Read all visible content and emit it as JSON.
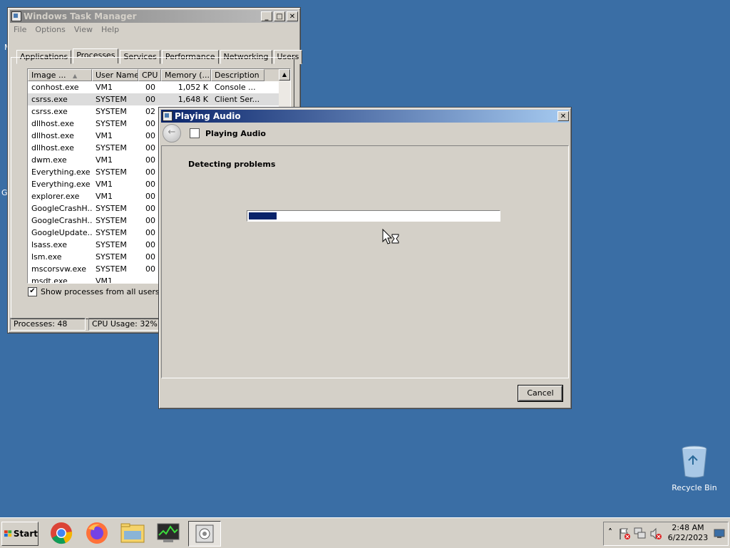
{
  "desktop": {
    "fragments": [
      "M",
      "G"
    ],
    "recycle_bin": {
      "label": "Recycle Bin",
      "icon": "recycle-bin-icon"
    }
  },
  "task_manager": {
    "title": "Windows Task Manager",
    "menu": [
      "File",
      "Options",
      "View",
      "Help"
    ],
    "tabs": [
      "Applications",
      "Processes",
      "Services",
      "Performance",
      "Networking",
      "Users"
    ],
    "selected_tab": "Processes",
    "columns": [
      "Image ...",
      "User Name",
      "CPU",
      "Memory (...",
      "Description"
    ],
    "rows": [
      [
        "conhost.exe",
        "VM1",
        "00",
        "1,052 K",
        "Console ..."
      ],
      [
        "csrss.exe",
        "SYSTEM",
        "00",
        "1,648 K",
        "Client Ser..."
      ],
      [
        "csrss.exe",
        "SYSTEM",
        "02",
        "",
        ""
      ],
      [
        "dllhost.exe",
        "SYSTEM",
        "00",
        "",
        ""
      ],
      [
        "dllhost.exe",
        "VM1",
        "00",
        "",
        ""
      ],
      [
        "dllhost.exe",
        "SYSTEM",
        "00",
        "",
        ""
      ],
      [
        "dwm.exe",
        "VM1",
        "00",
        "",
        ""
      ],
      [
        "Everything.exe",
        "SYSTEM",
        "00",
        "",
        ""
      ],
      [
        "Everything.exe",
        "VM1",
        "00",
        "",
        ""
      ],
      [
        "explorer.exe",
        "VM1",
        "00",
        "",
        ""
      ],
      [
        "GoogleCrashH...",
        "SYSTEM",
        "00",
        "",
        ""
      ],
      [
        "GoogleCrashH...",
        "SYSTEM",
        "00",
        "",
        ""
      ],
      [
        "GoogleUpdate...",
        "SYSTEM",
        "00",
        "",
        ""
      ],
      [
        "lsass.exe",
        "SYSTEM",
        "00",
        "",
        ""
      ],
      [
        "lsm.exe",
        "SYSTEM",
        "00",
        "",
        ""
      ],
      [
        "mscorsvw.exe",
        "SYSTEM",
        "00",
        "",
        ""
      ],
      [
        "msdt.exe",
        "VM1",
        "",
        "",
        ""
      ]
    ],
    "show_all_label": "Show processes from all users",
    "show_all_checked": "✔",
    "status_processes": "Processes: 48",
    "status_cpu": "CPU Usage: 32%"
  },
  "dialog": {
    "title": "Playing Audio",
    "nav_title": "Playing Audio",
    "heading": "Detecting problems",
    "progress": 0.11,
    "cancel_label": "Cancel"
  },
  "taskbar": {
    "start_label": "Start",
    "apps": [
      "chrome-icon",
      "firefox-icon",
      "file-explorer-icon",
      "task-manager-icon",
      "troubleshooter-icon"
    ],
    "tray_expand": "˄",
    "time": "2:48 AM",
    "date": "6/22/2023"
  },
  "colors": {
    "desktop": "#3a6ea5",
    "title_active": "#0a246a",
    "progress_fill": "#0a246a"
  }
}
